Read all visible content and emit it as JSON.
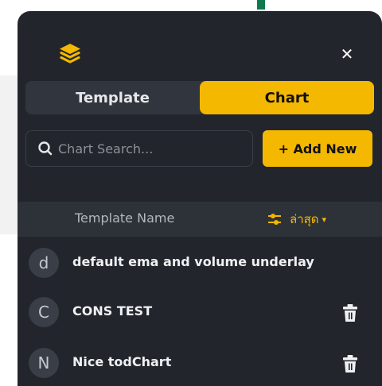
{
  "tabs": {
    "template": "Template",
    "chart": "Chart",
    "active": "chart"
  },
  "search": {
    "placeholder": "Chart Search..."
  },
  "add_button": "+ Add New",
  "list_header": {
    "column_name": "Template Name",
    "sort_label": "ล่าสุด"
  },
  "items": [
    {
      "initial": "d",
      "name": "default ema and volume underlay"
    },
    {
      "initial": "C",
      "name": "CONS TEST"
    },
    {
      "initial": "N",
      "name": "Nice todChart"
    }
  ],
  "colors": {
    "accent": "#f5b800",
    "panel": "#22262c"
  },
  "icons": [
    "layers-logo-icon",
    "close-icon",
    "search-icon",
    "sort-sliders-icon",
    "chevron-down-icon",
    "trash-icon"
  ]
}
